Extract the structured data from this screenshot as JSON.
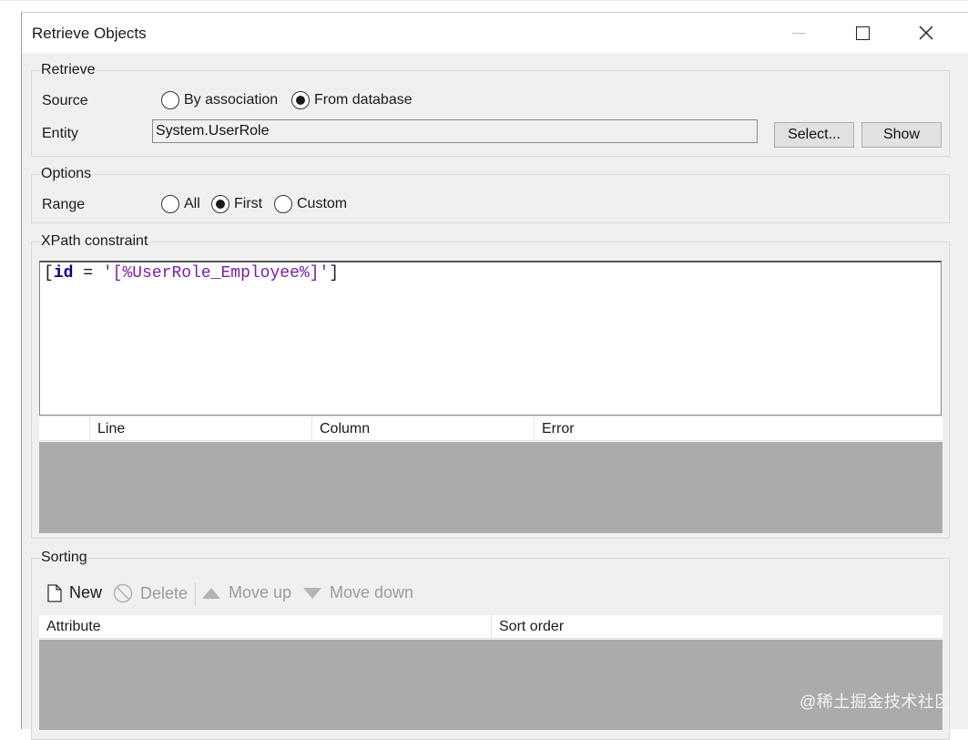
{
  "window": {
    "title": "Retrieve Objects"
  },
  "retrieve": {
    "legend": "Retrieve",
    "source_label": "Source",
    "source_options": [
      {
        "label": "By association",
        "selected": false
      },
      {
        "label": "From database",
        "selected": true
      }
    ],
    "entity_label": "Entity",
    "entity_value": "System.UserRole",
    "select_button": "Select...",
    "show_button": "Show"
  },
  "options": {
    "legend": "Options",
    "range_label": "Range",
    "range_options": [
      {
        "label": "All",
        "selected": false
      },
      {
        "label": "First",
        "selected": true
      },
      {
        "label": "Custom",
        "selected": false
      }
    ]
  },
  "xpath": {
    "legend": "XPath constraint",
    "expression_tokens": [
      {
        "text": "[",
        "kind": "punc"
      },
      {
        "text": "id",
        "kind": "kw"
      },
      {
        "text": " = ",
        "kind": "punc"
      },
      {
        "text": "'",
        "kind": "str"
      },
      {
        "text": "[%UserRole_Employee%]",
        "kind": "str"
      },
      {
        "text": "'",
        "kind": "str"
      },
      {
        "text": "]",
        "kind": "punc"
      }
    ],
    "error_columns": [
      "",
      "Line",
      "Column",
      "Error"
    ]
  },
  "sorting": {
    "legend": "Sorting",
    "toolbar": {
      "new": "New",
      "delete": "Delete",
      "move_up": "Move up",
      "move_down": "Move down"
    },
    "columns": [
      "Attribute",
      "Sort order"
    ]
  },
  "watermark": "@稀土掘金技术社区",
  "colors": {
    "keyword": "#00008b",
    "string": "#7b1fa2",
    "grid_empty": "#ababab",
    "disabled_text": "#9b9b9b"
  }
}
